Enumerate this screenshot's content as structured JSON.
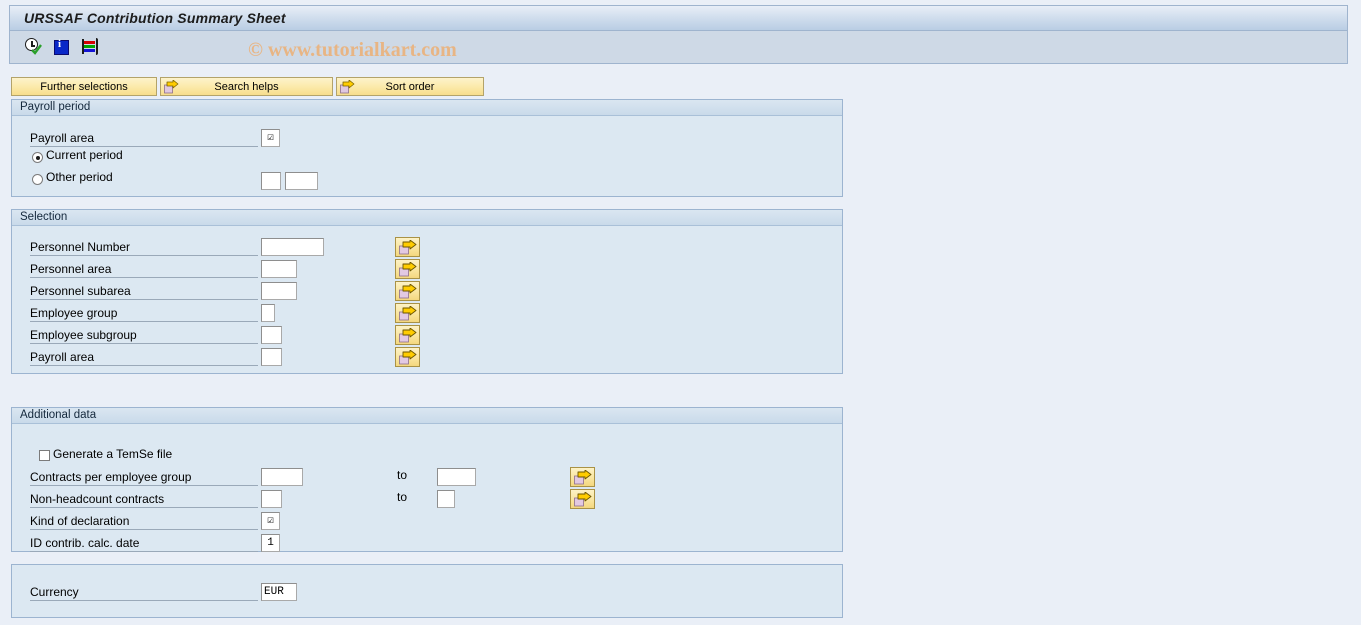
{
  "window": {
    "title": "URSSAF Contribution Summary Sheet"
  },
  "watermark": {
    "text": "© www.tutorialkart.com"
  },
  "toolbar": {
    "icons": [
      {
        "name": "execute-icon",
        "label": "Execute"
      },
      {
        "name": "info-icon",
        "label": "Information"
      },
      {
        "name": "variant-bars-icon",
        "label": "Get variant"
      }
    ]
  },
  "buttons": [
    {
      "label": "Further selections",
      "icon": "none"
    },
    {
      "label": "Search helps",
      "icon": "arrow-right-icon"
    },
    {
      "label": "Sort order",
      "icon": "arrow-right-icon"
    }
  ],
  "payroll_period": {
    "title": "Payroll period",
    "payroll_area_label": "Payroll area",
    "payroll_area_value": "☑",
    "current_period_label": "Current period",
    "other_period_label": "Other period",
    "other_period_value_1": "",
    "other_period_value_2": "",
    "selected_option": "Current period"
  },
  "selection": {
    "title": "Selection",
    "rows": [
      {
        "label": "Personnel Number",
        "value": ""
      },
      {
        "label": "Personnel area",
        "value": ""
      },
      {
        "label": "Personnel subarea",
        "value": ""
      },
      {
        "label": "Employee group",
        "value": ""
      },
      {
        "label": "Employee subgroup",
        "value": ""
      },
      {
        "label": "Payroll area",
        "value": ""
      }
    ]
  },
  "additional_data": {
    "title": "Additional data",
    "temse_label": "Generate a TemSe file",
    "temse_checked": false,
    "contracts_label": "Contracts per employee group",
    "contracts_from": "",
    "contracts_to_label": "to",
    "contracts_to": "",
    "nonheadcount_label": "Non-headcount contracts",
    "nonheadcount_from": "",
    "nonheadcount_to_label": "to",
    "nonheadcount_to": "",
    "kind_label": "Kind of declaration",
    "kind_value": "☑",
    "iddate_label": "ID contrib. calc. date",
    "iddate_value": "1"
  },
  "currency_section": {
    "label": "Currency",
    "value": "EUR"
  },
  "colors": {
    "title_bar": "#c5d6e8",
    "panel_bg": "#dce8f2",
    "body_bg": "#eaeff7",
    "button_yellow": "#f9e49c",
    "watermark": "#e8b584"
  }
}
